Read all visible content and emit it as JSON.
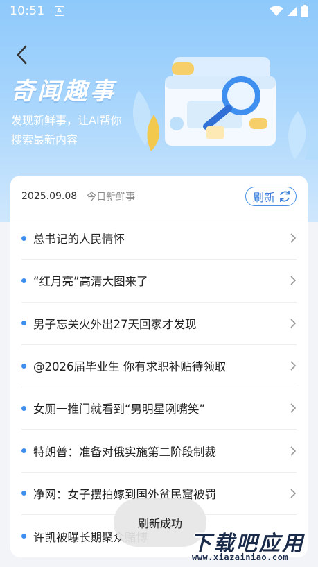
{
  "status_bar": {
    "time": "10:51",
    "notification_icon": "a-icon",
    "right_icons": [
      "wifi-icon",
      "signal-icon",
      "battery-icon"
    ]
  },
  "header": {
    "back_icon": "chevron-left-icon",
    "title": "奇闻趣事",
    "subtitle": "发现新鲜事，让AI帮你搜索最新内容"
  },
  "card": {
    "date": "2025.09.08",
    "date_label": "今日新鲜事",
    "refresh_label": "刷新",
    "items": [
      {
        "text": "总书记的人民情怀"
      },
      {
        "text": "“红月亮”高清大图来了"
      },
      {
        "text": "男子忘关火外出27天回家才发现"
      },
      {
        "text": "@2026届毕业生 你有求职补贴待领取"
      },
      {
        "text": "女厕一推门就看到“男明星咧嘴笑”"
      },
      {
        "text": "特朗普：准备对俄实施第二阶段制裁"
      },
      {
        "text": "净网：女子摆拍嫁到国外贫民窟被罚"
      },
      {
        "text": "许凯被曝长期聚众赌博"
      }
    ]
  },
  "toast": {
    "text": "刷新成功"
  },
  "watermark": {
    "main": "下载吧应用",
    "url": "www.xiazainiao.com"
  },
  "colors": {
    "accent": "#3f8ff0",
    "hero_top": "#8ec9fb",
    "background": "#f2f4f7"
  }
}
